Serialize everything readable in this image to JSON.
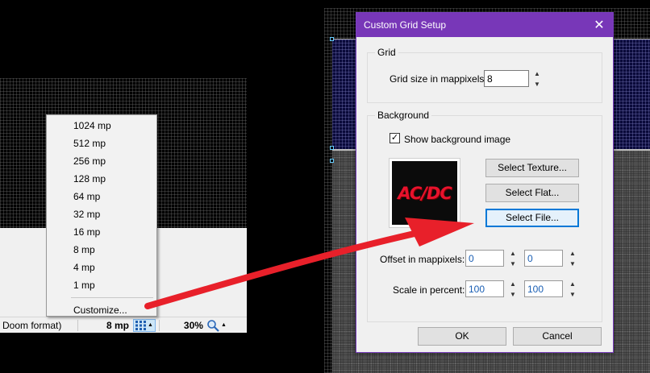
{
  "grid_menu": {
    "items": [
      {
        "label": "1024 mp"
      },
      {
        "label": "512 mp"
      },
      {
        "label": "256 mp"
      },
      {
        "label": "128 mp"
      },
      {
        "label": "64 mp"
      },
      {
        "label": "32 mp"
      },
      {
        "label": "16 mp"
      },
      {
        "label": "8 mp"
      },
      {
        "label": "4 mp"
      },
      {
        "label": "1 mp"
      }
    ],
    "customize_label": "Customize..."
  },
  "status_bar": {
    "format_text": "Doom format)",
    "grid_size": "8 mp",
    "zoom": "30%",
    "grid_icon": "grid-icon",
    "zoom_icon": "magnifier-icon"
  },
  "dialog": {
    "title": "Custom Grid Setup",
    "close_glyph": "✕",
    "grid_group": {
      "title": "Grid",
      "size_label": "Grid size in mappixels:",
      "size_value": "8"
    },
    "background_group": {
      "title": "Background",
      "show_image_label": "Show background image",
      "show_image_checked": true,
      "preview_text": "AC/DC",
      "select_texture": "Select Texture...",
      "select_flat": "Select Flat...",
      "select_file": "Select File...",
      "offset_label": "Offset in mappixels:",
      "offset_x": "0",
      "offset_y": "0",
      "scale_label": "Scale in percent:",
      "scale_x": "100",
      "scale_y": "100"
    },
    "ok_label": "OK",
    "cancel_label": "Cancel"
  },
  "colors": {
    "title_bar": "#7837b8",
    "annotation_arrow": "#e8202a",
    "logo_red": "#e8122c"
  }
}
